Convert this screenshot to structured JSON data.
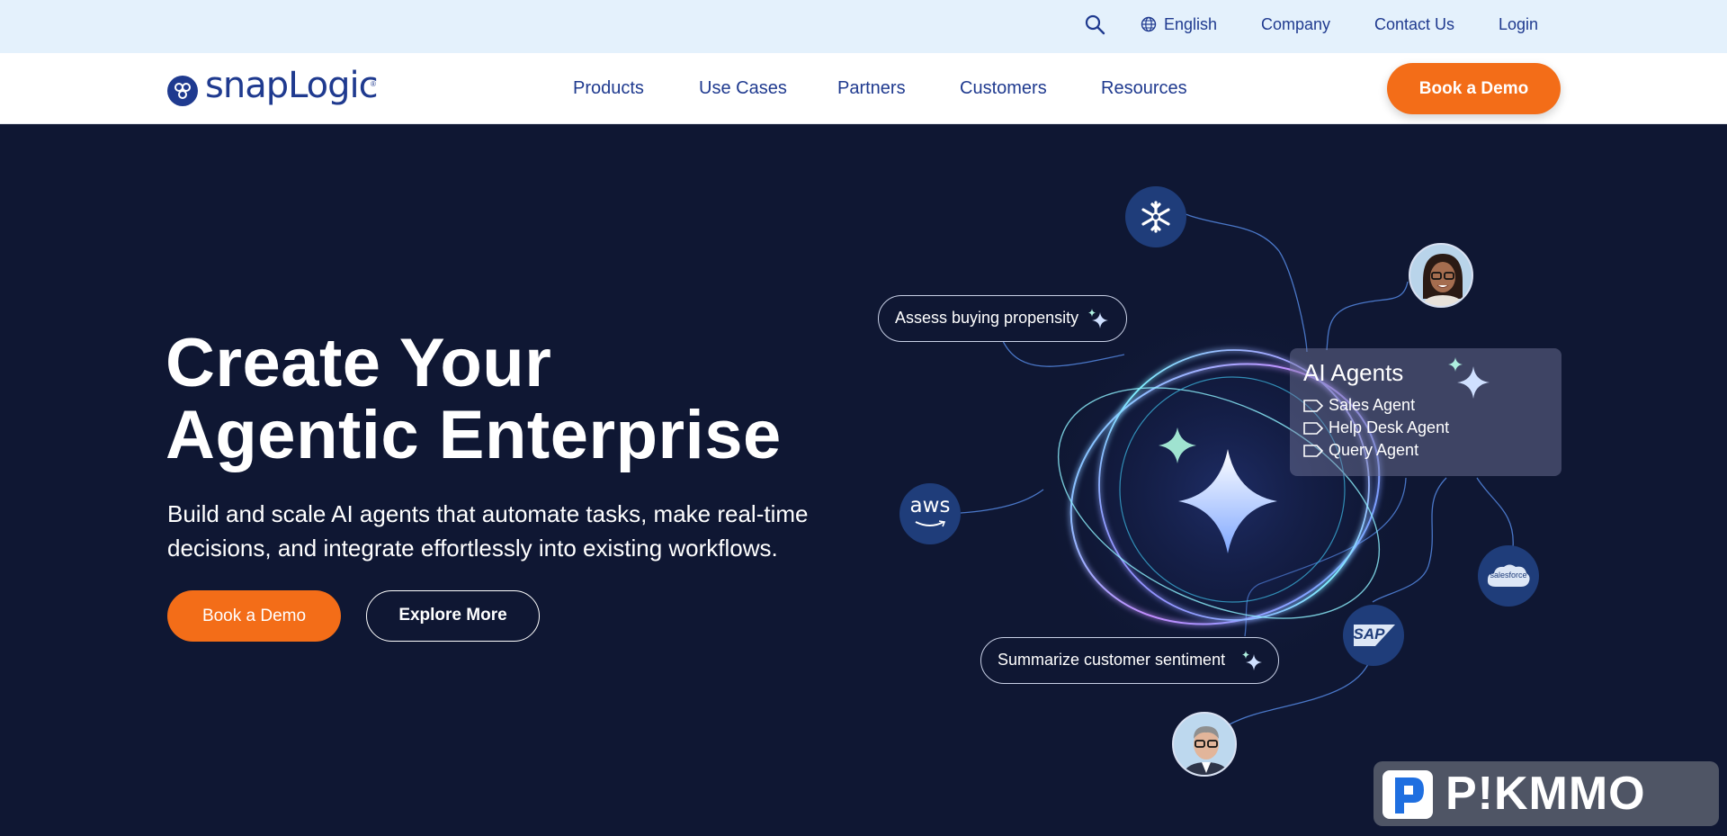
{
  "utility_bar": {
    "language": "English",
    "links": [
      "Company",
      "Contact Us",
      "Login"
    ]
  },
  "nav": {
    "logo_text": "snapLogic",
    "logo_reg": "®",
    "items": [
      "Products",
      "Use Cases",
      "Partners",
      "Customers",
      "Resources"
    ],
    "cta": "Book a Demo"
  },
  "hero": {
    "title_line1": "Create Your",
    "title_line2": "Agentic Enterprise",
    "subtitle_line1": "Build and scale AI agents that automate tasks, make real-time",
    "subtitle_line2": "decisions, and integrate effortlessly into existing workflows.",
    "primary_button": "Book a Demo",
    "secondary_button": "Explore More"
  },
  "illustration": {
    "pill_top": "Assess buying propensity",
    "pill_bottom": "Summarize customer sentiment",
    "agents_card": {
      "title": "AI Agents",
      "items": [
        "Sales Agent",
        "Help Desk Agent",
        "Query Agent"
      ]
    },
    "logos": {
      "aws": "aws",
      "salesforce": "salesforce",
      "sap": "SAP"
    }
  },
  "watermark": {
    "text": "P!KMMO"
  },
  "colors": {
    "brand_blue": "#1f3a8f",
    "accent_orange": "#f36d18",
    "hero_bg": "#0f1733",
    "utility_bg": "#e4f1fc"
  }
}
